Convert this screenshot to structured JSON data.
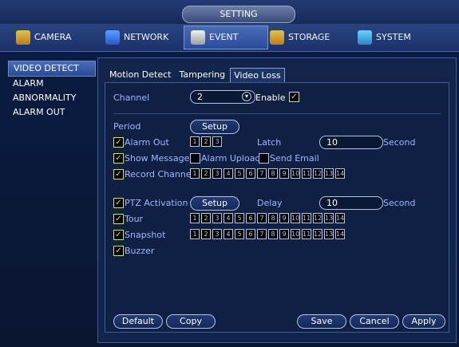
{
  "window": {
    "title": "SETTING"
  },
  "main_tabs": [
    {
      "label": "CAMERA",
      "icon": "camera-icon"
    },
    {
      "label": "NETWORK",
      "icon": "network-icon"
    },
    {
      "label": "EVENT",
      "icon": "event-icon"
    },
    {
      "label": "STORAGE",
      "icon": "storage-icon"
    },
    {
      "label": "SYSTEM",
      "icon": "system-icon"
    }
  ],
  "left_menu": [
    {
      "label": "VIDEO DETECT"
    },
    {
      "label": "ALARM"
    },
    {
      "label": "ABNORMALITY"
    },
    {
      "label": "ALARM OUT"
    }
  ],
  "sub_tabs": [
    {
      "label": "Motion Detect"
    },
    {
      "label": "Tampering"
    },
    {
      "label": "Video Loss"
    }
  ],
  "settings": {
    "channel_label": "Channel",
    "channel_value": "2",
    "enable_label": "Enable",
    "period_label": "Period",
    "setup_label": "Setup",
    "alarm_out_label": "Alarm Out",
    "latch_label": "Latch",
    "latch_value": "10",
    "second_label": "Second",
    "show_message_label": "Show Message",
    "alarm_upload_label": "Alarm Upload",
    "send_email_label": "Send Email",
    "record_channel_label": "Record Channel",
    "ptz_activation_label": "PTZ Activation",
    "delay_label": "Delay",
    "delay_value": "10",
    "tour_label": "Tour",
    "snapshot_label": "Snapshot",
    "buzzer_label": "Buzzer"
  },
  "alarm_out_numbers": [
    "1",
    "2",
    "3"
  ],
  "channel_numbers": [
    "1",
    "2",
    "3",
    "4",
    "5",
    "6",
    "7",
    "8",
    "9",
    "10",
    "11",
    "12",
    "13",
    "14"
  ],
  "buttons": {
    "default": "Default",
    "copy": "Copy",
    "save": "Save",
    "cancel": "Cancel",
    "apply": "Apply"
  },
  "colors": {
    "accent": "#d7df68",
    "label": "#9fb8ff",
    "panel_bg": "#0f2043"
  }
}
